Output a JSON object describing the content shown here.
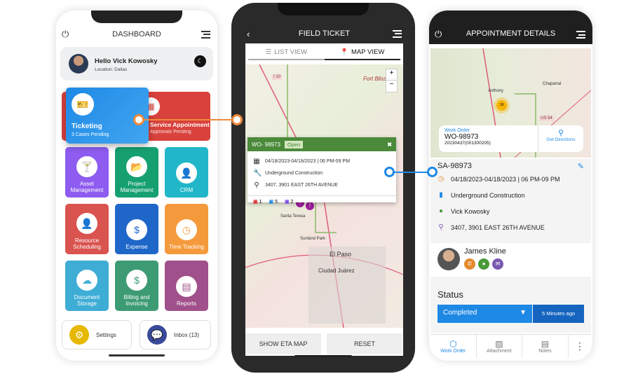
{
  "dashboard": {
    "title": "DASHBOARD",
    "greeting": "Hello Vick Kowosky",
    "location": "Location: Dallas",
    "ticketing": {
      "label": "Ticketing",
      "sub": "3 Cases Pending"
    },
    "service": {
      "label": "Service Appointment",
      "sub": "Approvals Pending"
    },
    "tiles": [
      {
        "label": "Asset Management",
        "icon": "cocktail-icon",
        "color": "#8e5cf0"
      },
      {
        "label": "Project Management",
        "icon": "folder-icon",
        "color": "#16a070"
      },
      {
        "label": "CRM",
        "icon": "user-gear-icon",
        "color": "#22b7c8"
      },
      {
        "label": "Resource Scheduling",
        "icon": "user-plus-icon",
        "color": "#d9534f"
      },
      {
        "label": "Expense",
        "icon": "dollar-icon",
        "color": "#1f66c9"
      },
      {
        "label": "Time Tracking",
        "icon": "clock-icon",
        "color": "#f59a3c"
      },
      {
        "label": "Document Storage",
        "icon": "cloud-download-icon",
        "color": "#3eadd6"
      },
      {
        "label": "Billing and Invoicing",
        "icon": "dollar-icon",
        "color": "#3d9b74"
      },
      {
        "label": "Reports",
        "icon": "report-icon",
        "color": "#a0508a"
      }
    ],
    "settings": "Settings",
    "inbox": "Inbox (13)"
  },
  "field": {
    "title": "FIELD TICKET",
    "list_view": "LIST VIEW",
    "map_view": "MAP VIEW",
    "zoom_in": "+",
    "zoom_out": "−",
    "map_labels": {
      "i10": "I 10",
      "fort": "Fort Bliss",
      "santa": "Santa Teresa",
      "sunland": "Sunland Park",
      "elpaso": "El Paso",
      "juarez": "Ciudad Juárez"
    },
    "popup": {
      "wo": "WO- 98973",
      "status": "Open",
      "date": "04/18/2023-04/18/2023 | 06 PM-09 PM",
      "type": "Underground Construction",
      "address": "3407, 3901 EAST 26TH AVENUE",
      "counts": [
        "1",
        "5",
        "2"
      ]
    },
    "show_eta": "SHOW ETA MAP",
    "reset": "RESET"
  },
  "appt": {
    "title": "APPOINTMENT DETAILS",
    "map_labels": {
      "anthony": "Anthony",
      "chaparral": "Chaparral",
      "us54": "US 54",
      "cluster": "19"
    },
    "wo_label": "Work Order",
    "wo": "WO-98973",
    "wo_sub": "20230437(001300205)",
    "directions": "Get Directions",
    "sa": "SA-98973",
    "date": "04/18/2023-04/18/2023 | 06 PM-09 PM",
    "type": "Underground Construction",
    "person": "Vick Kowosky",
    "address": "3407, 3901 EAST 26TH AVENUE",
    "tech": "James Kline",
    "status_label": "Status",
    "status": "Completed",
    "time_ago": "5 Minutes ago",
    "tabs": [
      "Work Order",
      "Attachment",
      "Notes"
    ]
  },
  "colors": {
    "blue": "#1e88e5",
    "red": "#d9423c",
    "green": "#4a8a3a",
    "orange": "#f08a3c"
  }
}
